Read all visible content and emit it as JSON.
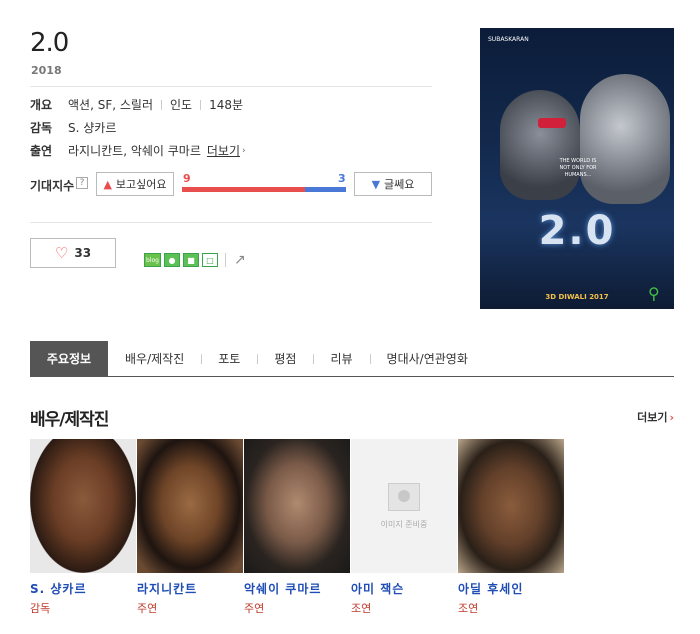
{
  "movie": {
    "title": "2.0",
    "year": "2018",
    "info": {
      "overview_label": "개요",
      "genres": "액션, SF, 스릴러",
      "country": "인도",
      "runtime": "148분",
      "director_label": "감독",
      "director": "S. 샹카르",
      "cast_label": "출연",
      "cast": "라지니칸트, 악쉐이 쿠마르",
      "cast_more": "더보기"
    },
    "expectation": {
      "label": "기대지수",
      "help": "?",
      "want_label": "보고싶어요",
      "meh_label": "글쎄요",
      "want_count": "9",
      "meh_count": "3",
      "want_ratio": 0.75
    },
    "like": {
      "count": "33"
    },
    "share": {
      "blog": "blog",
      "share_icon": "share-icon"
    },
    "poster": {
      "top_text": "SUBASKARAN",
      "logo_text": "2.0",
      "tagline": "THE WORLD IS NOT ONLY FOR HUMANS...",
      "release": "3D DIWALI 2017"
    }
  },
  "tabs": [
    {
      "label": "주요정보"
    },
    {
      "label": "배우/제작진"
    },
    {
      "label": "포토"
    },
    {
      "label": "평점"
    },
    {
      "label": "리뷰"
    },
    {
      "label": "명대사/연관영화"
    }
  ],
  "crew_section": {
    "title": "배우/제작진",
    "more": "더보기",
    "people": [
      {
        "name": "S. 샹카르",
        "role": "감독"
      },
      {
        "name": "라지니칸트",
        "role": "주연"
      },
      {
        "name": "악쉐이 쿠마르",
        "role": "주연"
      },
      {
        "name": "아미 잭슨",
        "role": "조연",
        "no_image_text": "이미지 준비중"
      },
      {
        "name": "아딜 후세인",
        "role": "조연"
      }
    ]
  },
  "colors": {
    "accent_red": "#e84e4e",
    "accent_blue": "#4a78d6",
    "link_blue": "#1f4db6",
    "tab_active": "#555555"
  }
}
